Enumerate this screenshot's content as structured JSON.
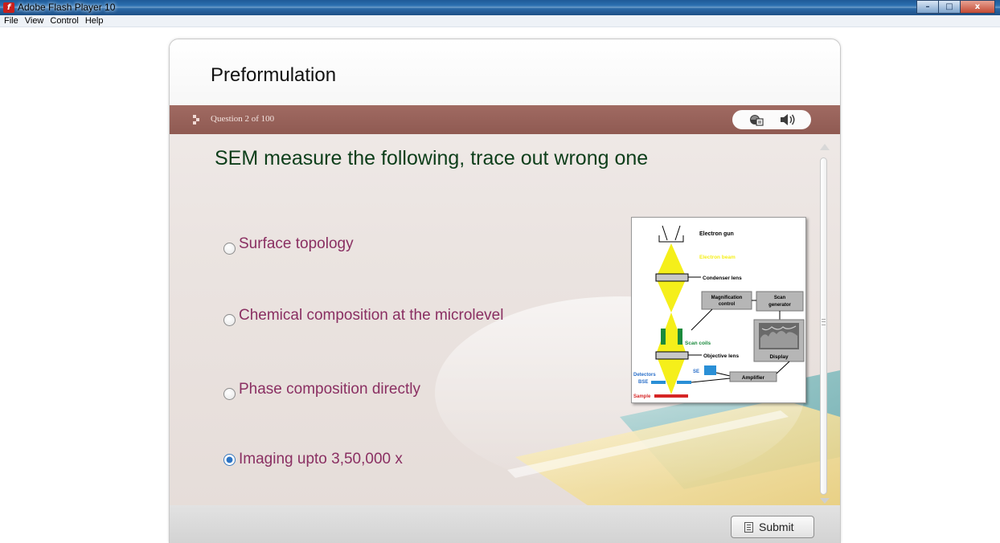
{
  "window": {
    "app_icon": "flash-icon",
    "title": "Adobe Flash Player 10",
    "controls": [
      "minimize-icon",
      "maximize-icon",
      "close-icon"
    ]
  },
  "menu": [
    "File",
    "View",
    "Control",
    "Help"
  ],
  "course": {
    "title": "Preformulation"
  },
  "question_bar": {
    "label": "Question 2 of 100",
    "icons": [
      "review-icon",
      "audio-icon"
    ]
  },
  "question": {
    "text": "SEM measure the following, trace out wrong one",
    "options": [
      {
        "label": "Surface topology",
        "selected": false
      },
      {
        "label": "Chemical composition at the microlevel",
        "selected": false
      },
      {
        "label": "Phase composition directly",
        "selected": false
      },
      {
        "label": "Imaging upto 3,50,000 x",
        "selected": true
      }
    ]
  },
  "diagram": {
    "labels": {
      "electron_gun": "Electron gun",
      "electron_beam": "Electron beam",
      "condenser_lens": "Condenser lens",
      "magnification_control_1": "Magnification",
      "magnification_control_2": "control",
      "scan_generator_1": "Scan",
      "scan_generator_2": "generator",
      "scan_coils": "Scan coils",
      "objective_lens": "Objective lens",
      "display": "Display",
      "detectors": "Detectors",
      "se": "SE",
      "bse": "BSE",
      "amplifier": "Amplifier",
      "sample": "Sample"
    },
    "colors": {
      "beam": "#f5ef1a",
      "scan_coils": "#1a8a3c",
      "detector": "#2a8fd6",
      "sample": "#d62525",
      "detector_text": "#2a6fc9"
    }
  },
  "actions": {
    "submit_label": "Submit",
    "submit_icon": "submit-icon"
  },
  "colors": {
    "header_bar": "#995f57",
    "question_text": "#0d3e1a",
    "option_text": "#8a2f62",
    "selected_radio": "#2b73c4"
  }
}
